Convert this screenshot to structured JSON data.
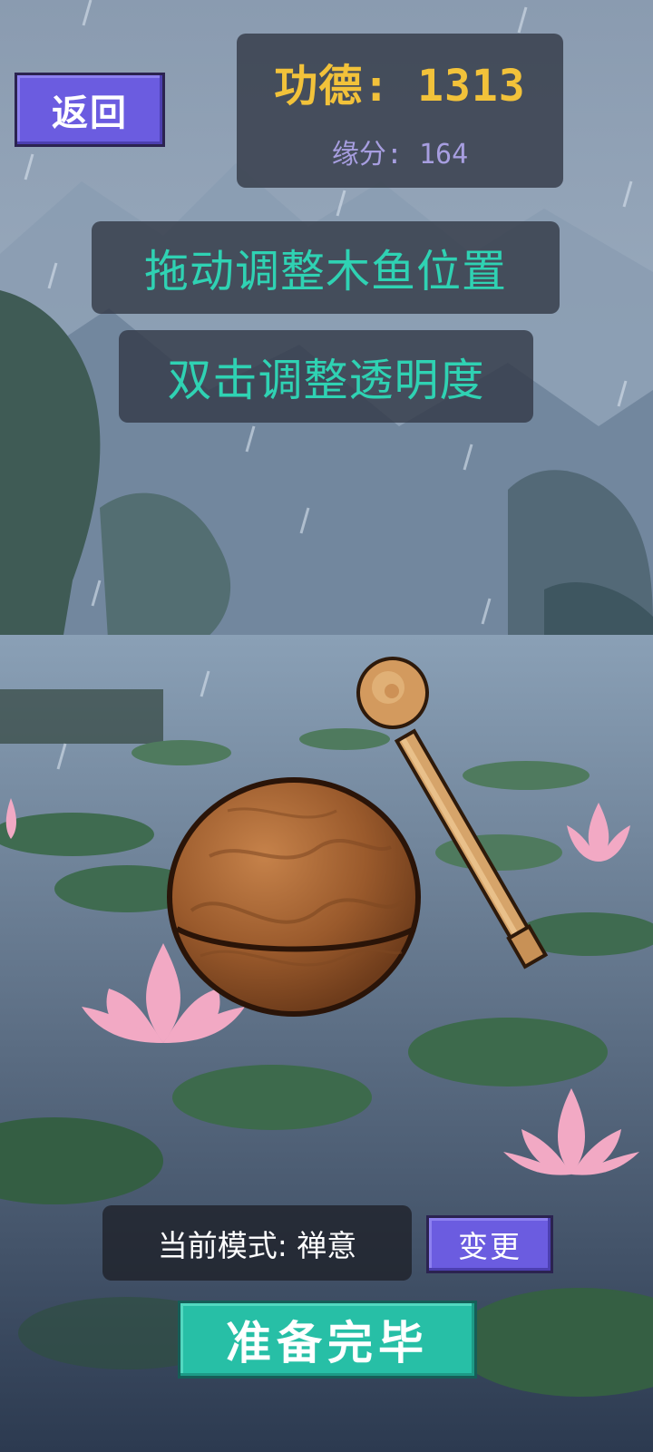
{
  "header": {
    "back_label": "返回",
    "merit_label": "功德: 1313",
    "fate_label": "缘分: 164"
  },
  "hints": {
    "drag_hint": "拖动调整木鱼位置",
    "double_tap_hint": "双击调整透明度"
  },
  "mode": {
    "current_mode_label": "当前模式: 禅意",
    "change_label": "变更"
  },
  "footer": {
    "ready_label": "准备完毕"
  },
  "colors": {
    "merit_text": "#f2c23a",
    "fate_text": "#a79ee0",
    "hint_text": "#2fd2b3",
    "purple_button": "#6b5ce0",
    "teal_button": "#27bfa6"
  },
  "icons": {
    "wooden_fish": "wooden-fish-icon",
    "mallet": "mallet-icon"
  }
}
